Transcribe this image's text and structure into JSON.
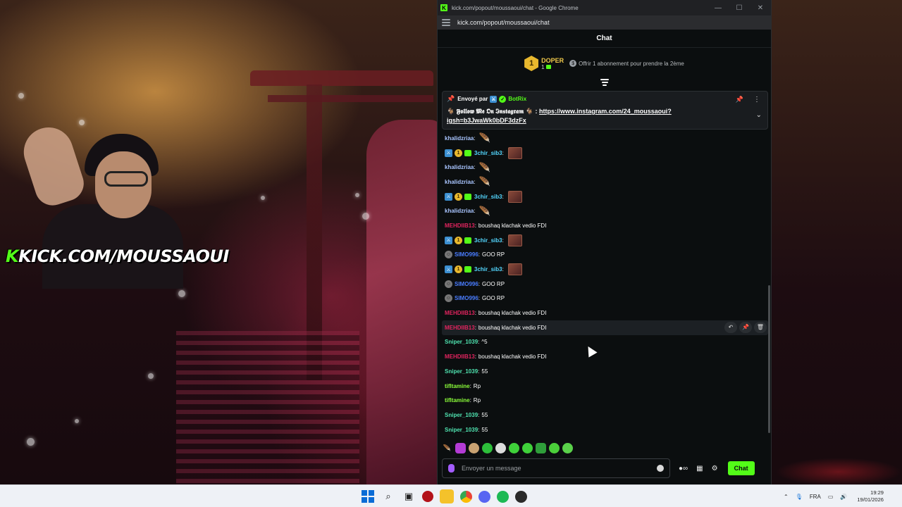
{
  "stream": {
    "overlay_prefix": "K",
    "overlay_text": "KICK.COM/MOUSSAOUI"
  },
  "window": {
    "title": "kick.com/popout/moussaoui/chat - Google Chrome",
    "url": "kick.com/popout/moussaoui/chat",
    "favicon": "K",
    "controls": [
      "—",
      "☐",
      "✕"
    ]
  },
  "chat": {
    "header": "Chat",
    "sub_banner": {
      "rank": "1",
      "name": "DOPER",
      "count": "1",
      "gift_text": "Offrir 1 abonnement pour prendre la 2ème"
    },
    "pinned": {
      "sent_by_label": "Envoyé par",
      "sender": "BotRix",
      "text_prefix": "🐐 𝕱𝖔𝖑𝖑𝖔𝖜 𝕸𝖊 𝕺𝖓 𝕴𝖓𝖘𝖙𝖆𝖌𝖗𝖆𝖒 🐐 : ",
      "link": "https://www.instagram.com/24_moussaoui?igsh=b3JwaWk0bDF3dzFx"
    },
    "messages": [
      {
        "user": "khalidzriaa",
        "color": "#a9c5ff",
        "text": "",
        "emote": "feather-pink"
      },
      {
        "user": "3chir_sib3",
        "color": "#53d7ff",
        "text": "",
        "emote": "image",
        "badges": true
      },
      {
        "user": "khalidzriaa",
        "color": "#a9c5ff",
        "text": "",
        "emote": "feather-purple"
      },
      {
        "user": "khalidzriaa",
        "color": "#a9c5ff",
        "text": "",
        "emote": "feather-teal"
      },
      {
        "user": "3chir_sib3",
        "color": "#53d7ff",
        "text": "",
        "emote": "image",
        "badges": true
      },
      {
        "user": "khalidzriaa",
        "color": "#a9c5ff",
        "text": "",
        "emote": "feather-gold"
      },
      {
        "user": "MEHDIIB13",
        "color": "#e0245e",
        "text": "boushaq klachak vedio FDI"
      },
      {
        "user": "3chir_sib3",
        "color": "#53d7ff",
        "text": "",
        "emote": "image",
        "badges": true
      },
      {
        "user": "SIMO996",
        "color": "#4a7dff",
        "text": "GOO RP",
        "avatar": true
      },
      {
        "user": "3chir_sib3",
        "color": "#53d7ff",
        "text": "",
        "emote": "image",
        "badges": true
      },
      {
        "user": "SIMO996",
        "color": "#4a7dff",
        "text": "GOO RP",
        "avatar": true
      },
      {
        "user": "SIMO996",
        "color": "#4a7dff",
        "text": "GOO RP",
        "avatar": true
      },
      {
        "user": "MEHDIIB13",
        "color": "#e0245e",
        "text": "boushaq klachak vedio FDI"
      },
      {
        "user": "MEHDIIB13",
        "color": "#e0245e",
        "text": "boushaq klachak vedio FDI",
        "highlight": true
      },
      {
        "user": "Sniper_1039",
        "color": "#4fe3b0",
        "text": "^5"
      },
      {
        "user": "MEHDIIB13",
        "color": "#e0245e",
        "text": "boushaq klachak vedio FDI"
      },
      {
        "user": "Sniper_1039",
        "color": "#4fe3b0",
        "text": "55"
      },
      {
        "user": "tifltamine",
        "color": "#8bff3a",
        "text": "Rp"
      },
      {
        "user": "tifltamine",
        "color": "#8bff3a",
        "text": "Rp"
      },
      {
        "user": "Sniper_1039",
        "color": "#4fe3b0",
        "text": "55"
      },
      {
        "user": "Sniper_1039",
        "color": "#4fe3b0",
        "text": "55"
      }
    ],
    "message_actions": [
      "↶",
      "📌",
      "🗑"
    ],
    "input_placeholder": "Envoyer un message",
    "send_label": "Chat"
  },
  "taskbar": {
    "lang": "FRA",
    "time": "19:29",
    "date": "19/01/2026"
  }
}
